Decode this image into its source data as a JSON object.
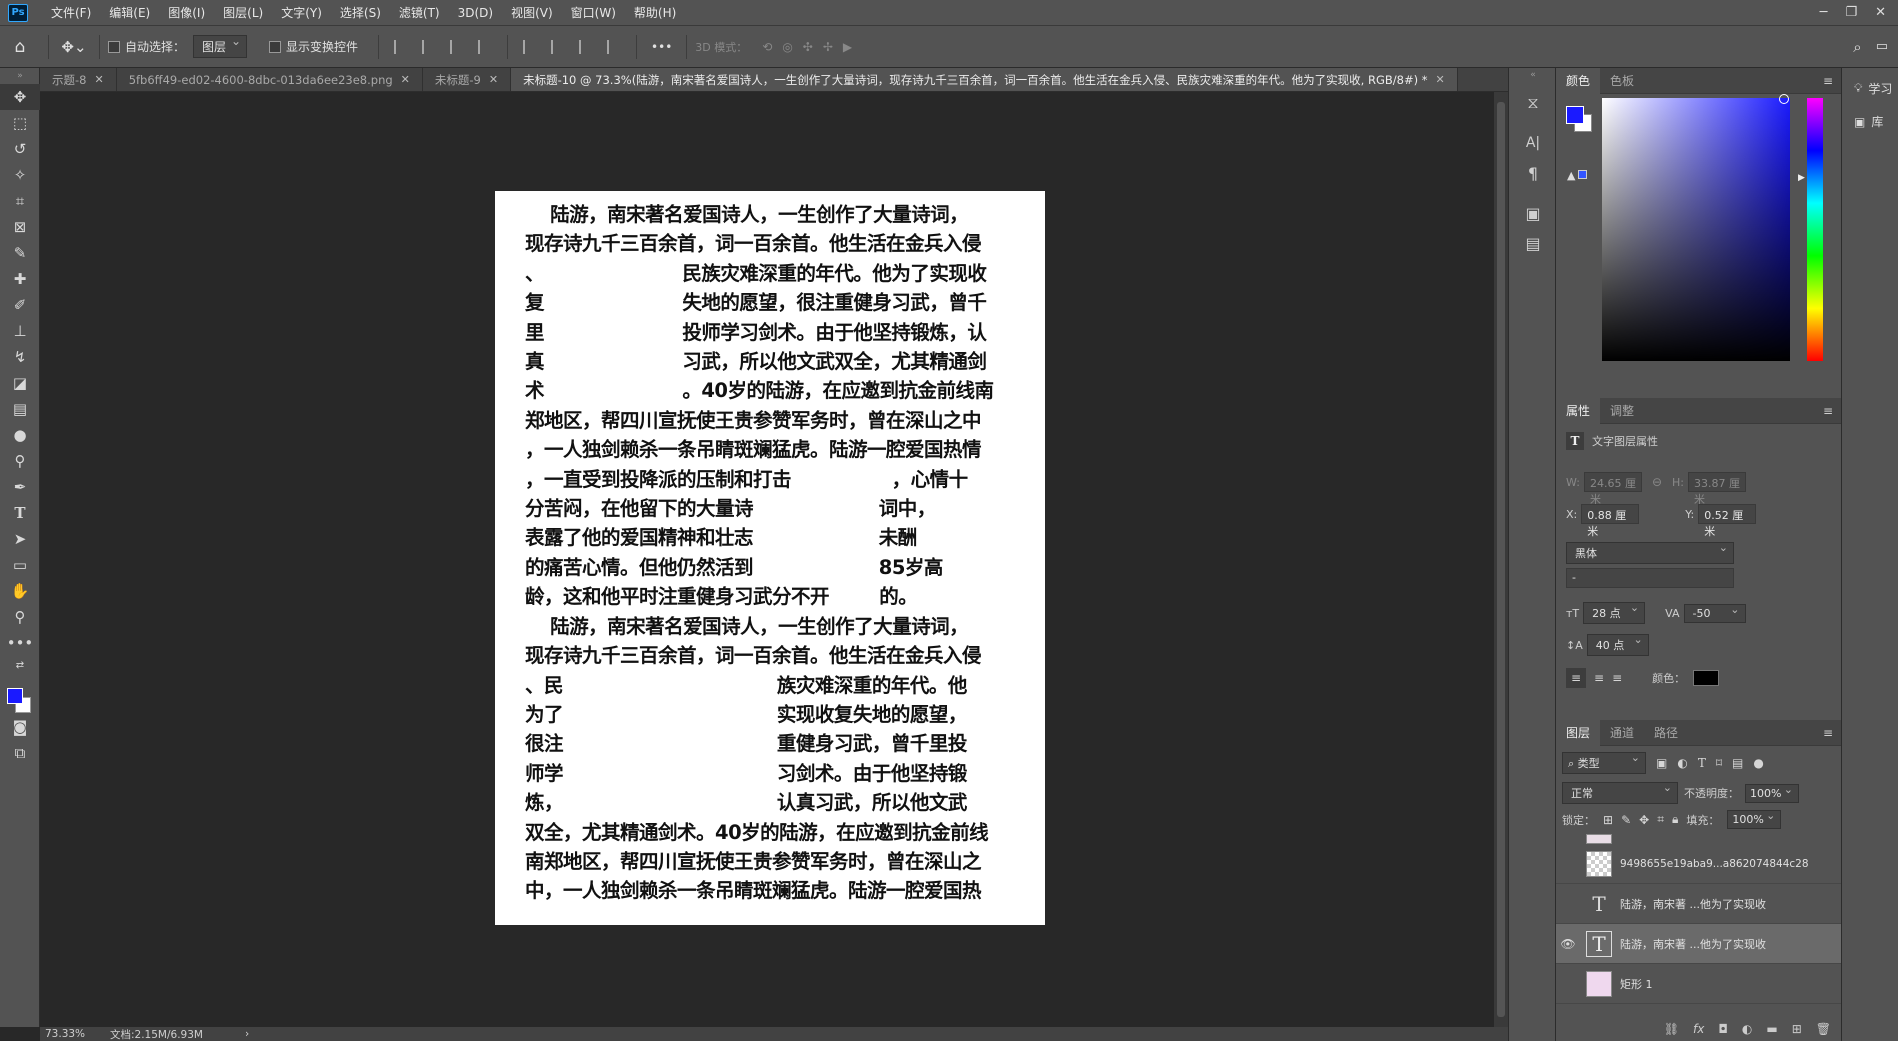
{
  "menubar": {
    "logo": "Ps",
    "items": [
      "文件(F)",
      "编辑(E)",
      "图像(I)",
      "图层(L)",
      "文字(Y)",
      "选择(S)",
      "滤镜(T)",
      "3D(D)",
      "视图(V)",
      "窗口(W)",
      "帮助(H)"
    ]
  },
  "options": {
    "auto_select_label": "自动选择：",
    "auto_select_value": "图层",
    "show_transform_label": "显示变换控件",
    "more": "•••",
    "mode3d_label": "3D 模式："
  },
  "tabs": [
    {
      "label": "示题-8",
      "active": false
    },
    {
      "label": "5fb6ff49-ed02-4600-8dbc-013da6ee23e8.png",
      "active": false
    },
    {
      "label": "未标题-9",
      "active": false
    },
    {
      "label": "未标题-10 @ 73.3%(陆游，南宋著名爱国诗人，一生创作了大量诗词，现存诗九千三百余首，词一百余首。他生活在金兵入侵、民族灾难深重的年代。他为了实现收, RGB/8#) *",
      "active": true
    }
  ],
  "document": {
    "lines": [
      "    陆游，南宋著名爱国诗人，一生创作了大量诗词，",
      "现存诗九千三百余首，词一百余首。他生活在金兵入侵",
      "、                      民族灾难深重的年代。他为了实现收",
      "复                      失地的愿望，很注重健身习武，曾千",
      "里                      投师学习剑术。由于他坚持锻炼，认",
      "真                      习武，所以他文武双全，尤其精通剑",
      "术                      。40岁的陆游，在应邀到抗金前线南",
      "郑地区，帮四川宣抚使王贵参赞军务时，曾在深山之中",
      "，一人独剑赖杀一条吊睛斑斓猛虎。陆游一腔爱国热情",
      "，一直受到投降派的压制和打击                ，心情十",
      "分苦闷，在他留下的大量诗                    词中，",
      "表露了他的爱国精神和壮志                    未酬",
      "的痛苦心情。但他仍然活到                    85岁高",
      "龄，这和他平时注重健身习武分不开        的。",
      "    陆游，南宋著名爱国诗人，一生创作了大量诗词，",
      "现存诗九千三百余首，词一百余首。他生活在金兵入侵",
      "、民                                  族灾难深重的年代。他",
      "为了                                  实现收复失地的愿望，",
      "很注                                  重健身习武，曾千里投",
      "师学                                  习剑术。由于他坚持锻",
      "炼，                                  认真习武，所以他文武",
      "双全，尤其精通剑术。40岁的陆游，在应邀到抗金前线",
      "南郑地区，帮四川宣抚使王贵参赞军务时，曾在深山之",
      "中，一人独剑赖杀一条吊睛斑斓猛虎。陆游一腔爱国热"
    ]
  },
  "status": {
    "zoom": "73.33%",
    "doc_size": "文档:2.15M/6.93M",
    "arrow": "›"
  },
  "color_panel": {
    "tabs": [
      "颜色",
      "色板"
    ],
    "fg_color": "#1a1aff",
    "bg_color": "#ffffff"
  },
  "properties_panel": {
    "tabs": [
      "属性",
      "调整"
    ],
    "title": "文字图层属性",
    "w_label": "W:",
    "w_value": "24.65 厘米",
    "h_label": "H:",
    "h_value": "33.87 厘米",
    "x_label": "X:",
    "x_value": "0.88 厘米",
    "y_label": "Y:",
    "y_value": "0.52 厘米",
    "font_family": "黑体",
    "font_style": "-",
    "font_size": "28 点",
    "tracking": "-50",
    "leading": "40 点",
    "color_label": "颜色："
  },
  "layers_panel": {
    "tabs": [
      "图层",
      "通道",
      "路径"
    ],
    "filter_label": "类型",
    "blend_mode": "正常",
    "opacity_label": "不透明度：",
    "opacity_value": "100%",
    "lock_label": "锁定：",
    "fill_label": "填充：",
    "fill_value": "100%",
    "layers": [
      {
        "name": "9498655e19aba9...a862074844c28",
        "type": "image",
        "visible": false,
        "selected": false
      },
      {
        "name": "陆游，南宋著 ...他为了实现收",
        "type": "text",
        "visible": false,
        "selected": false
      },
      {
        "name": "陆游，南宋著 ...他为了实现收",
        "type": "text",
        "visible": true,
        "selected": true
      },
      {
        "name": "矩形 1",
        "type": "shape",
        "visible": false,
        "selected": false
      }
    ]
  },
  "farstrip": {
    "learn_label": "学习",
    "library_label": "库"
  }
}
